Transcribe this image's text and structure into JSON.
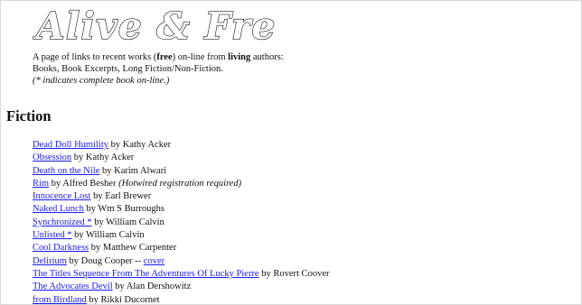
{
  "header": {
    "logo_text": "Alive & Free"
  },
  "intro": {
    "part1": "A page of links to recent works (",
    "part2": "free",
    "part3": ") on-line from ",
    "part4": "living",
    "part5": " authors: Books, Book Excerpts, Long Fiction/Non-Fiction.",
    "note": "(* indicates complete book on-line.)"
  },
  "section": {
    "heading": "Fiction"
  },
  "entries": [
    {
      "title": "Dead Doll Humility",
      "by": " by Kathy Acker",
      "extra": "",
      "extra_link": ""
    },
    {
      "title": "Obsession",
      "by": " by Kathy Acker",
      "extra": "",
      "extra_link": ""
    },
    {
      "title": "Death on the Nile",
      "by": " by Karim Alwari",
      "extra": "",
      "extra_link": ""
    },
    {
      "title": "Rim",
      "by": " by Alfred Besher ",
      "extra": "(Hotwired registration required)",
      "extra_link": ""
    },
    {
      "title": "Innocence Lost",
      "by": " by Earl Brewer",
      "extra": "",
      "extra_link": ""
    },
    {
      "title": "Naked Lunch",
      "by": " by Wm S Burroughs",
      "extra": "",
      "extra_link": ""
    },
    {
      "title": "Synchronized *",
      "by": " by William Calvin",
      "extra": "",
      "extra_link": ""
    },
    {
      "title": "Unlisted *",
      "by": " by William Calvin",
      "extra": "",
      "extra_link": ""
    },
    {
      "title": "Cool Darkness",
      "by": " by Matthew Carpenter",
      "extra": "",
      "extra_link": ""
    },
    {
      "title": "Delirium",
      "by": " by Doug Cooper -- ",
      "extra": "",
      "extra_link": "cover"
    },
    {
      "title": "The Titles Sequence From The Adventures Of Lucky Pierre",
      "by": " by Rovert Coover",
      "extra": "",
      "extra_link": ""
    },
    {
      "title": "The Advocates Devil",
      "by": " by Alan Dershowitz",
      "extra": "",
      "extra_link": ""
    },
    {
      "title": "from Birdland",
      "by": " by Rikki Ducornet",
      "extra": "",
      "extra_link": ""
    }
  ]
}
